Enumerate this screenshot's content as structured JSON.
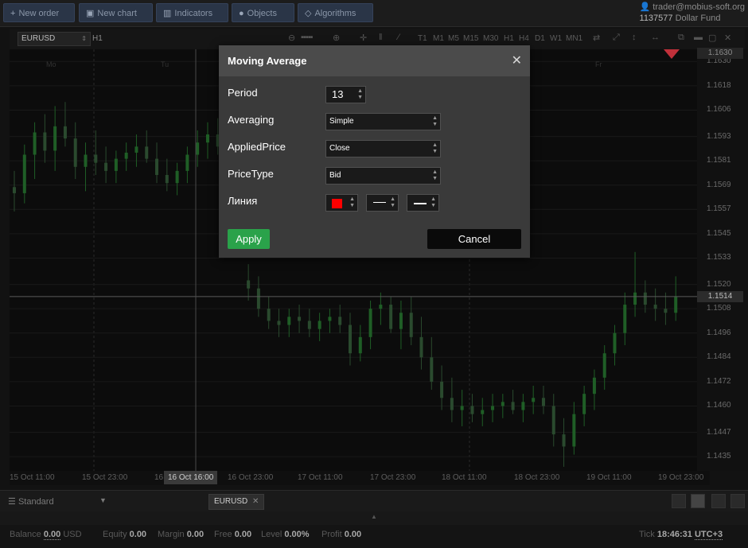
{
  "toolbar": {
    "buttons": [
      {
        "label": "New order",
        "icon": "plus-icon"
      },
      {
        "label": "New chart",
        "icon": "chart-icon"
      },
      {
        "label": "Indicators",
        "icon": "bars-icon"
      },
      {
        "label": "Objects",
        "icon": "objects-icon"
      },
      {
        "label": "Algorithms",
        "icon": "diamond-icon"
      }
    ]
  },
  "account": {
    "email": "trader@mobius-soft.org",
    "number": "1137577",
    "name": "Dollar Fund"
  },
  "chart_toolbar": {
    "symbol": "EURUSD",
    "timeframe": "H1",
    "timeframes": [
      "T1",
      "M1",
      "M5",
      "M15",
      "M30",
      "H1",
      "H4",
      "D1",
      "W1",
      "MN1"
    ]
  },
  "chart_data": {
    "type": "candlestick",
    "y_ticks": [
      "1.1630",
      "1.1618",
      "1.1606",
      "1.1593",
      "1.1581",
      "1.1569",
      "1.1557",
      "1.1545",
      "1.1533",
      "1.1520",
      "1.1508",
      "1.1496",
      "1.1484",
      "1.1472",
      "1.1460",
      "1.1447",
      "1.1435"
    ],
    "current_price": "1.1514",
    "x_ticks": [
      "15 Oct 11:00",
      "15 Oct 23:00",
      "16",
      "16 Oct 23:00",
      "17 Oct 11:00",
      "17 Oct 23:00",
      "18 Oct 11:00",
      "18 Oct 23:00",
      "19 Oct 11:00",
      "19 Oct 23:00"
    ],
    "crosshair_time": "16 Oct 16:00",
    "day_labels": [
      "Mo",
      "Tu",
      "Fr"
    ],
    "ylim": [
      1.1428,
      1.1636
    ],
    "candles": [
      {
        "o": 1.1568,
        "h": 1.1576,
        "l": 1.1556,
        "c": 1.1565
      },
      {
        "o": 1.1565,
        "h": 1.1589,
        "l": 1.156,
        "c": 1.1584
      },
      {
        "o": 1.1584,
        "h": 1.16,
        "l": 1.1572,
        "c": 1.1595
      },
      {
        "o": 1.1595,
        "h": 1.1604,
        "l": 1.158,
        "c": 1.1586
      },
      {
        "o": 1.1586,
        "h": 1.1608,
        "l": 1.1576,
        "c": 1.1598
      },
      {
        "o": 1.1598,
        "h": 1.161,
        "l": 1.1588,
        "c": 1.1592
      },
      {
        "o": 1.1592,
        "h": 1.16,
        "l": 1.1572,
        "c": 1.1578
      },
      {
        "o": 1.1578,
        "h": 1.159,
        "l": 1.1566,
        "c": 1.1584
      },
      {
        "o": 1.1584,
        "h": 1.1596,
        "l": 1.1574,
        "c": 1.158
      },
      {
        "o": 1.158,
        "h": 1.1588,
        "l": 1.157,
        "c": 1.1576
      },
      {
        "o": 1.1576,
        "h": 1.1586,
        "l": 1.157,
        "c": 1.1582
      },
      {
        "o": 1.1582,
        "h": 1.159,
        "l": 1.1576,
        "c": 1.1585
      },
      {
        "o": 1.1585,
        "h": 1.1594,
        "l": 1.1578,
        "c": 1.1588
      },
      {
        "o": 1.1588,
        "h": 1.1596,
        "l": 1.158,
        "c": 1.1582
      },
      {
        "o": 1.1582,
        "h": 1.159,
        "l": 1.157,
        "c": 1.1574
      },
      {
        "o": 1.1574,
        "h": 1.1582,
        "l": 1.1566,
        "c": 1.157
      },
      {
        "o": 1.157,
        "h": 1.158,
        "l": 1.1564,
        "c": 1.1576
      },
      {
        "o": 1.1576,
        "h": 1.1588,
        "l": 1.157,
        "c": 1.1584
      },
      {
        "o": 1.1584,
        "h": 1.1596,
        "l": 1.1578,
        "c": 1.159
      },
      {
        "o": 1.159,
        "h": 1.16,
        "l": 1.1582,
        "c": 1.1594
      },
      {
        "o": 1.1594,
        "h": 1.1602,
        "l": 1.1584,
        "c": 1.1588
      },
      {
        "o": 1.1588,
        "h": 1.16,
        "l": 1.1582,
        "c": 1.1596
      },
      {
        "o": 1.1596,
        "h": 1.1608,
        "l": 1.159,
        "c": 1.16
      },
      {
        "o": 1.1522,
        "h": 1.153,
        "l": 1.1512,
        "c": 1.1518
      },
      {
        "o": 1.1518,
        "h": 1.1524,
        "l": 1.1504,
        "c": 1.1508
      },
      {
        "o": 1.1508,
        "h": 1.1514,
        "l": 1.1498,
        "c": 1.1502
      },
      {
        "o": 1.1502,
        "h": 1.1508,
        "l": 1.1494,
        "c": 1.15
      },
      {
        "o": 1.15,
        "h": 1.1508,
        "l": 1.1494,
        "c": 1.1504
      },
      {
        "o": 1.1504,
        "h": 1.151,
        "l": 1.1496,
        "c": 1.1502
      },
      {
        "o": 1.1502,
        "h": 1.1508,
        "l": 1.1494,
        "c": 1.1498
      },
      {
        "o": 1.1498,
        "h": 1.1506,
        "l": 1.1492,
        "c": 1.1502
      },
      {
        "o": 1.1502,
        "h": 1.1508,
        "l": 1.1496,
        "c": 1.1504
      },
      {
        "o": 1.1504,
        "h": 1.151,
        "l": 1.1496,
        "c": 1.15
      },
      {
        "o": 1.15,
        "h": 1.1506,
        "l": 1.148,
        "c": 1.1486
      },
      {
        "o": 1.1486,
        "h": 1.15,
        "l": 1.1482,
        "c": 1.1494
      },
      {
        "o": 1.1494,
        "h": 1.1512,
        "l": 1.1488,
        "c": 1.1508
      },
      {
        "o": 1.1508,
        "h": 1.1516,
        "l": 1.15,
        "c": 1.151
      },
      {
        "o": 1.151,
        "h": 1.1514,
        "l": 1.1496,
        "c": 1.1498
      },
      {
        "o": 1.1498,
        "h": 1.1512,
        "l": 1.1488,
        "c": 1.1506
      },
      {
        "o": 1.1506,
        "h": 1.1514,
        "l": 1.149,
        "c": 1.1494
      },
      {
        "o": 1.1494,
        "h": 1.1504,
        "l": 1.1478,
        "c": 1.1484
      },
      {
        "o": 1.1484,
        "h": 1.1494,
        "l": 1.1468,
        "c": 1.1472
      },
      {
        "o": 1.1472,
        "h": 1.148,
        "l": 1.1458,
        "c": 1.1464
      },
      {
        "o": 1.1464,
        "h": 1.1474,
        "l": 1.1452,
        "c": 1.1458
      },
      {
        "o": 1.1458,
        "h": 1.1468,
        "l": 1.145,
        "c": 1.146
      },
      {
        "o": 1.146,
        "h": 1.1466,
        "l": 1.1452,
        "c": 1.1456
      },
      {
        "o": 1.1456,
        "h": 1.1464,
        "l": 1.145,
        "c": 1.1458
      },
      {
        "o": 1.1458,
        "h": 1.1466,
        "l": 1.1452,
        "c": 1.146
      },
      {
        "o": 1.146,
        "h": 1.1466,
        "l": 1.1454,
        "c": 1.1462
      },
      {
        "o": 1.1462,
        "h": 1.1468,
        "l": 1.1456,
        "c": 1.1458
      },
      {
        "o": 1.1458,
        "h": 1.1466,
        "l": 1.1452,
        "c": 1.1462
      },
      {
        "o": 1.1462,
        "h": 1.147,
        "l": 1.1456,
        "c": 1.1464
      },
      {
        "o": 1.1464,
        "h": 1.147,
        "l": 1.1456,
        "c": 1.146
      },
      {
        "o": 1.146,
        "h": 1.1466,
        "l": 1.144,
        "c": 1.1446
      },
      {
        "o": 1.1446,
        "h": 1.1454,
        "l": 1.143,
        "c": 1.144
      },
      {
        "o": 1.144,
        "h": 1.1462,
        "l": 1.1436,
        "c": 1.1456
      },
      {
        "o": 1.1456,
        "h": 1.147,
        "l": 1.145,
        "c": 1.1466
      },
      {
        "o": 1.1466,
        "h": 1.1478,
        "l": 1.1458,
        "c": 1.1474
      },
      {
        "o": 1.1474,
        "h": 1.149,
        "l": 1.1468,
        "c": 1.1486
      },
      {
        "o": 1.1486,
        "h": 1.15,
        "l": 1.148,
        "c": 1.1496
      },
      {
        "o": 1.1496,
        "h": 1.1516,
        "l": 1.149,
        "c": 1.151
      },
      {
        "o": 1.151,
        "h": 1.1536,
        "l": 1.1504,
        "c": 1.1516
      },
      {
        "o": 1.1516,
        "h": 1.1522,
        "l": 1.1506,
        "c": 1.151
      },
      {
        "o": 1.151,
        "h": 1.1518,
        "l": 1.1502,
        "c": 1.1508
      },
      {
        "o": 1.1508,
        "h": 1.1516,
        "l": 1.15,
        "c": 1.1506
      },
      {
        "o": 1.1506,
        "h": 1.1524,
        "l": 1.1502,
        "c": 1.1514
      }
    ]
  },
  "dialog": {
    "title": "Moving Average",
    "fields": {
      "period": {
        "label": "Period",
        "value": "13"
      },
      "averaging": {
        "label": "Averaging",
        "value": "Simple"
      },
      "applied_price": {
        "label": "AppliedPrice",
        "value": "Close"
      },
      "price_type": {
        "label": "PriceType",
        "value": "Bid"
      },
      "line": {
        "label": "Линия",
        "color": "#ff0000"
      }
    },
    "apply_label": "Apply",
    "cancel_label": "Cancel"
  },
  "bottom": {
    "layout": "Standard",
    "chart_tab": "EURUSD"
  },
  "status": {
    "balance_label": "Balance",
    "balance_value": "0.00",
    "currency": "USD",
    "equity_label": "Equity",
    "equity_value": "0.00",
    "margin_label": "Margin",
    "margin_value": "0.00",
    "free_label": "Free",
    "free_value": "0.00",
    "level_label": "Level",
    "level_value": "0.00%",
    "profit_label": "Profit",
    "profit_value": "0.00",
    "tick_label": "Tick",
    "tick_time": "18:46:31",
    "timezone": "UTC+3"
  },
  "colors": {
    "bull": "#1f5e26",
    "bear": "#2a4a2e",
    "apply": "#2aa24a",
    "accent": "#2a3547"
  }
}
